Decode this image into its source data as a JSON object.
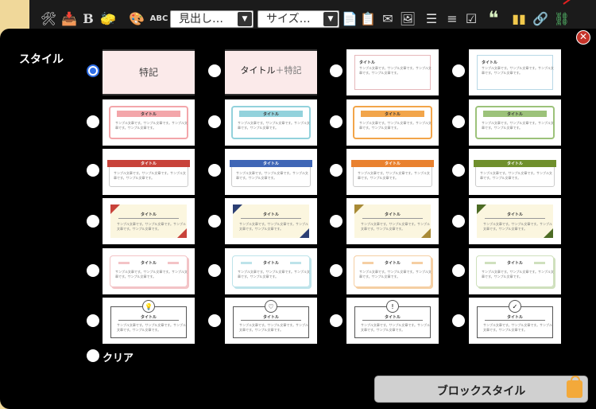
{
  "toolbar": {
    "bold_label": "B",
    "spell_label": "ABC",
    "heading_select": "見出し…",
    "size_select": "サイズ…",
    "quote_glyph": "❝"
  },
  "dialog": {
    "style_label": "スタイル",
    "clear_label": "クリア",
    "block_style_button": "ブロックスタイル",
    "close_glyph": "✕"
  },
  "cards": {
    "tokki": "特記",
    "title_tokki": "タイトル",
    "title_tokki_plus": "＋特記",
    "title": "タイトル",
    "sample": "サンプル文章です。サンプル文章です。サンプル文章です。サンプル文章です。"
  },
  "colors": {
    "pink": "#f3a6aa",
    "blue": "#93d2dc",
    "orange": "#f2a54a",
    "green": "#9cc27a",
    "red": "#c8423a",
    "navy": "#3f66b6",
    "deep_orange": "#e9812f",
    "olive": "#6f8f2c"
  }
}
